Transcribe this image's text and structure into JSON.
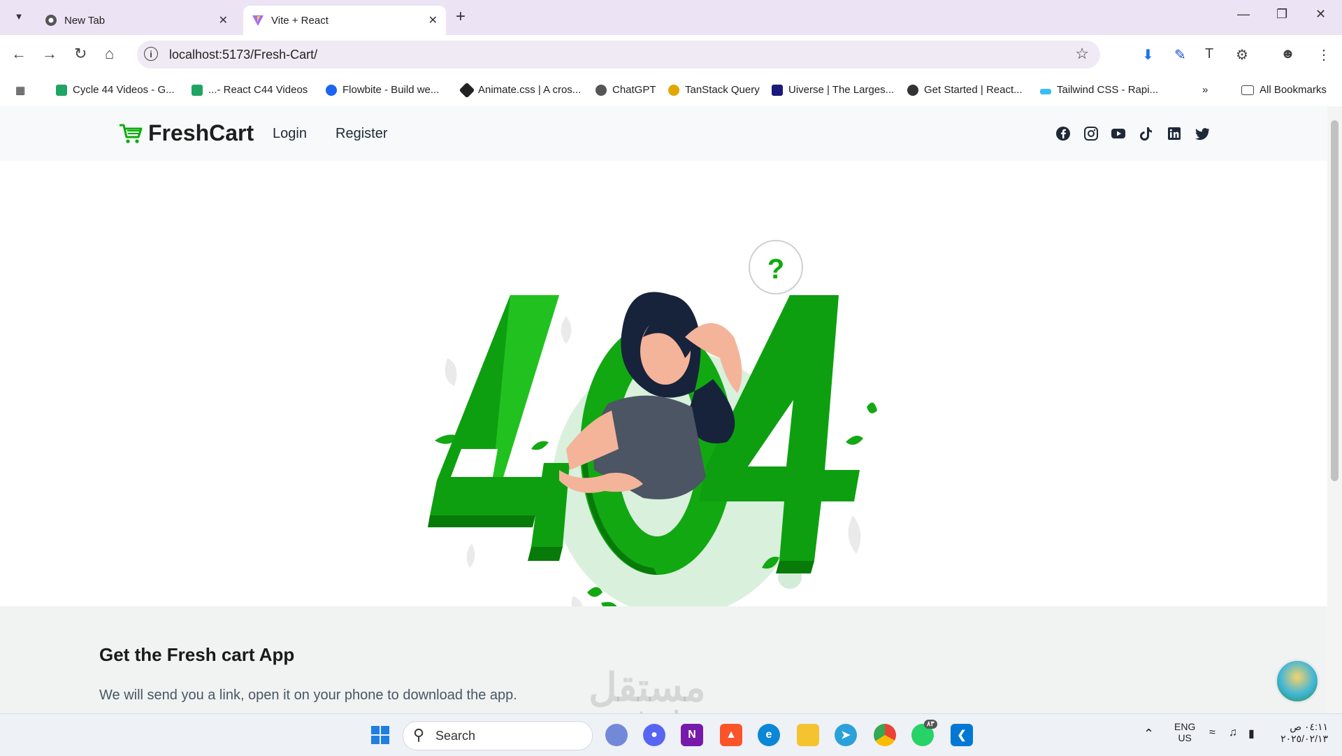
{
  "browser": {
    "tabs": [
      {
        "title": "New Tab",
        "active": false
      },
      {
        "title": "Vite + React",
        "active": true
      }
    ],
    "url": "localhost:5173/Fresh-Cart/",
    "bookmarks": [
      {
        "label": "Cycle 44 Videos - G...",
        "color": "#1fa463"
      },
      {
        "label": "...- React C44 Videos",
        "color": "#1fa463"
      },
      {
        "label": "Flowbite - Build we...",
        "color": "#1c64f2"
      },
      {
        "label": "Animate.css | A cros...",
        "color": "#222222"
      },
      {
        "label": "ChatGPT",
        "color": "#444444"
      },
      {
        "label": "TanStack Query",
        "color": "#e0a800"
      },
      {
        "label": "Uiverse | The Larges...",
        "color": "#1a1a7a"
      },
      {
        "label": "Get Started | React...",
        "color": "#333333"
      },
      {
        "label": "Tailwind CSS - Rapi...",
        "color": "#38bdf8"
      }
    ],
    "all_bookmarks": "All Bookmarks"
  },
  "site": {
    "brand": "FreshCart",
    "brand_color": "#0aad0a",
    "nav": {
      "login": "Login",
      "register": "Register"
    },
    "social_icons": [
      "facebook-icon",
      "instagram-icon",
      "youtube-icon",
      "tiktok-icon",
      "linkedin-icon",
      "twitter-icon"
    ],
    "not_found": {
      "code": "404",
      "question": "?"
    },
    "footer": {
      "title": "Get the Fresh cart App",
      "text": "We will send you a link, open it on your phone to download the app."
    }
  },
  "watermark": {
    "arabic": "مستقل",
    "latin": "mostaql.com"
  },
  "taskbar": {
    "search": "Search",
    "lang": "ENG",
    "region": "US",
    "time": "٠٤:١١ ص",
    "date": "٢٠٢٥/٠٢/١٣",
    "whatsapp_badge": "٨٣"
  }
}
